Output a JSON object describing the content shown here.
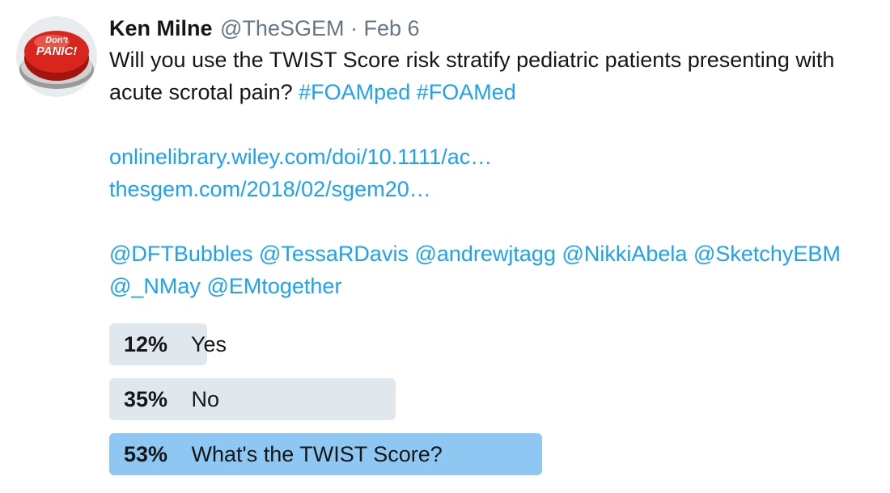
{
  "colors": {
    "link": "#1da1f2",
    "muted": "#657786",
    "poll_bar": "#e1e8ed",
    "poll_bar_winner": "#8ec8f2",
    "avatar_button_red": "#d9261c"
  },
  "avatar": {
    "icon": "dont-panic-button-icon",
    "line1": "Don't",
    "line2": "PANIC!"
  },
  "tweet": {
    "name": "Ken Milne",
    "handle": "@TheSGEM",
    "separator": "·",
    "date": "Feb 6",
    "text": "Will you use the TWIST Score risk stratify pediatric patients presenting with acute scrotal pain?",
    "hashtags": [
      "#FOAMped",
      "#FOAMed"
    ],
    "links": [
      "onlinelibrary.wiley.com/doi/10.1111/ac…",
      "thesgem.com/2018/02/sgem20…"
    ],
    "mentions_line1": [
      "@DFTBubbles",
      "@TessaRDavis",
      "@andrewjtagg",
      "@NikkiAbela",
      "@SketchyEBM"
    ],
    "mentions_line2": [
      "@_NMay",
      "@EMtogether"
    ]
  },
  "poll": {
    "choices": [
      {
        "percent_label": "12%",
        "label": "Yes",
        "fraction": 0.12,
        "winner": false
      },
      {
        "percent_label": "35%",
        "label": "No",
        "fraction": 0.35,
        "winner": false
      },
      {
        "percent_label": "53%",
        "label": "What's the TWIST Score?",
        "fraction": 0.53,
        "winner": true
      }
    ]
  }
}
